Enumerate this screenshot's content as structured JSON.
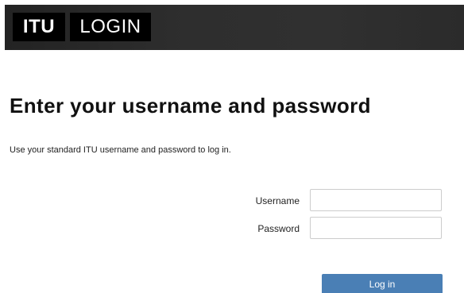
{
  "header": {
    "logo_primary": "ITU",
    "logo_secondary": "LOGIN"
  },
  "main": {
    "title": "Enter your username and password",
    "instructions": "Use your standard ITU username and password to log in."
  },
  "form": {
    "username_label": "Username",
    "username_value": "",
    "password_label": "Password",
    "password_value": "",
    "submit_label": "Log in"
  },
  "colors": {
    "header_background": "#2b2b2b",
    "logo_background": "#000000",
    "button_background": "#4a7fb5",
    "input_border": "#cccccc"
  }
}
